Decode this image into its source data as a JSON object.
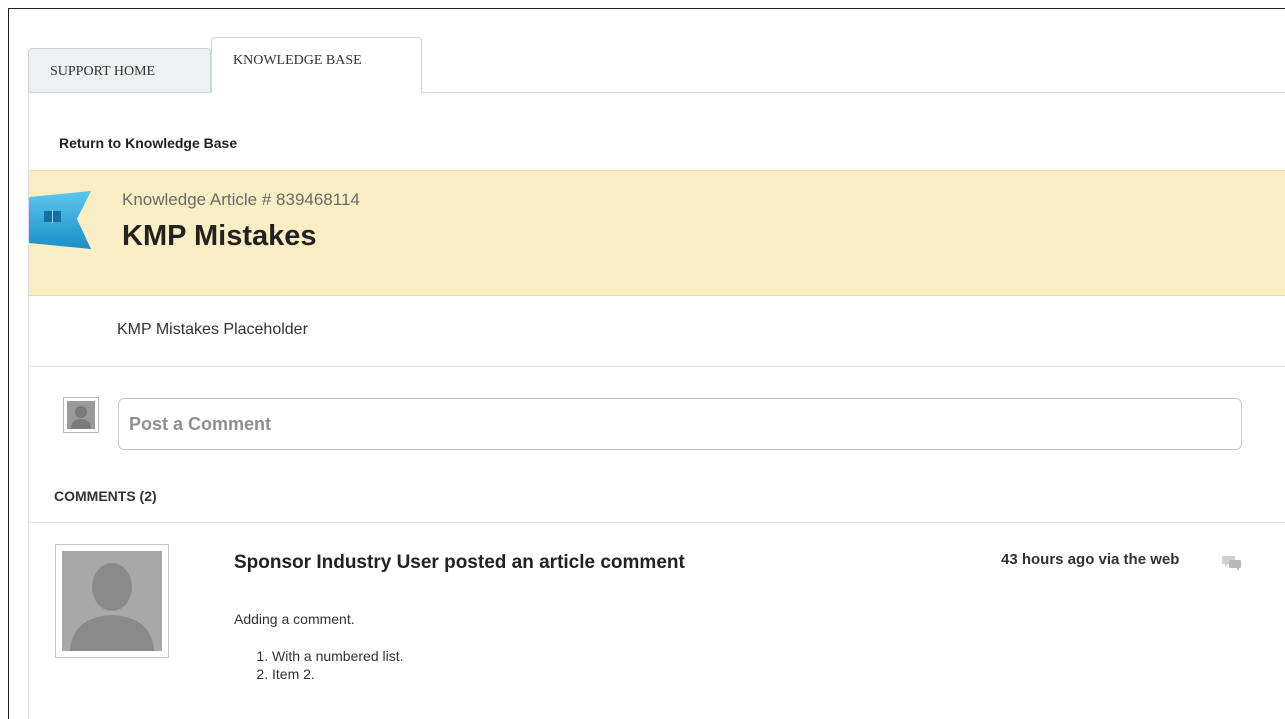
{
  "tabs": [
    {
      "label": "SUPPORT HOME",
      "active": false
    },
    {
      "label": "KNOWLEDGE BASE",
      "active": true
    }
  ],
  "return_link": "Return to Knowledge Base",
  "article": {
    "number_label": "Knowledge Article # 839468114",
    "title": "KMP Mistakes",
    "body": "KMP Mistakes Placeholder",
    "icon": "book-icon",
    "accent_color": "#2aa6d8"
  },
  "comment_box": {
    "placeholder": "Post a Comment"
  },
  "comments": {
    "header": "COMMENTS (2)",
    "items": [
      {
        "author_line": "Sponsor Industry User posted an article comment",
        "time": "43 hours ago via the web",
        "text": "Adding a comment.",
        "list": [
          "With a numbered list.",
          "Item 2."
        ]
      }
    ]
  },
  "colors": {
    "header_background": "#fbeec5",
    "tab_inactive_background": "#eef1f2"
  }
}
